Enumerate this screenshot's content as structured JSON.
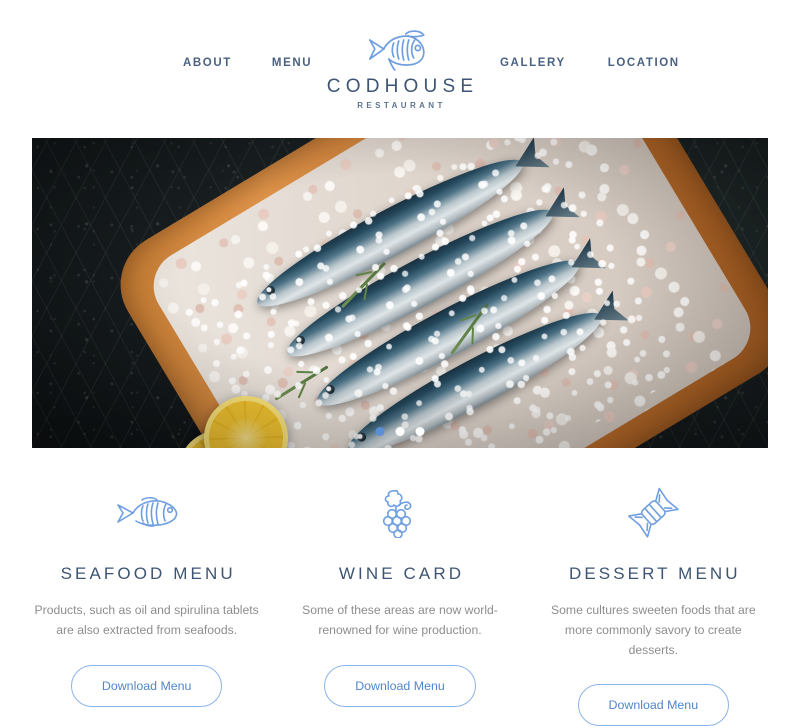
{
  "header": {
    "nav_left": [
      {
        "label": "ABOUT",
        "name": "nav-item-about"
      },
      {
        "label": "MENU",
        "name": "nav-item-menu"
      }
    ],
    "nav_right": [
      {
        "label": "GALLERY",
        "name": "nav-item-gallery"
      },
      {
        "label": "LOCATION",
        "name": "nav-item-location"
      }
    ],
    "brand": {
      "name": "CODHOUSE",
      "subtitle": "RESTAURANT",
      "logo_icon": "fish-logo-icon"
    }
  },
  "hero": {
    "alt": "Fresh sardines on coarse salt in a wooden tray with lemon slices",
    "carousel": {
      "active_index": 0,
      "slides": [
        {
          "name": "carousel-dot-1"
        },
        {
          "name": "carousel-dot-2"
        },
        {
          "name": "carousel-dot-3"
        }
      ]
    }
  },
  "features": [
    {
      "icon": "fish-icon",
      "title": "SEAFOOD MENU",
      "text": "Products, such as oil and spirulina tablets are also extracted from seafoods.",
      "button_label": "Download Menu"
    },
    {
      "icon": "grapes-icon",
      "title": "WINE CARD",
      "text": "Some of these areas are now world-renowned for wine production.",
      "button_label": "Download Menu"
    },
    {
      "icon": "candy-icon",
      "title": "DESSERT MENU",
      "text": "Some cultures sweeten foods that are more commonly savory to create desserts.",
      "button_label": "Download Menu"
    }
  ],
  "colors": {
    "accent_blue": "#5a8fd8",
    "icon_blue": "#6f9fe0",
    "heading_slate": "#3d5573",
    "body_gray": "#8d8d8d",
    "button_border": "#8cb4e8",
    "page_background": "#ffffff"
  }
}
